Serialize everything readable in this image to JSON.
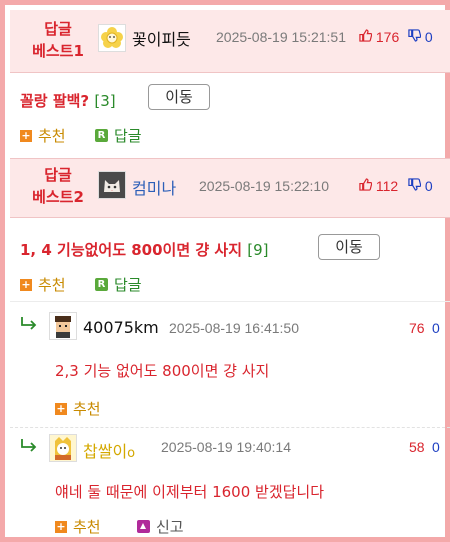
{
  "best1": {
    "label_line1": "답글",
    "label_line2": "베스트1",
    "nick": "꽃이피듯",
    "date": "2025-08-19 15:21:51",
    "up": "176",
    "down": "0",
    "title": "꼴랑 팔백?",
    "count": "[3]",
    "move_btn": "이동",
    "recommend": "추천",
    "reply": "답글",
    "avatar_icon": "flower-icon"
  },
  "best2": {
    "label_line1": "답글",
    "label_line2": "베스트2",
    "nick": "컴미나",
    "date": "2025-08-19 15:22:10",
    "up": "112",
    "down": "0",
    "title": "1, 4 기능없어도 800이면 걍 사지",
    "count": "[9]",
    "move_btn": "이동",
    "recommend": "추천",
    "reply": "답글",
    "avatar_icon": "cat-icon"
  },
  "replies": [
    {
      "nick": "40075km",
      "date": "2025-08-19 16:41:50",
      "up": "76",
      "down": "0",
      "text": "2,3 기능 없어도 800이면 걍 사지",
      "recommend": "추천"
    },
    {
      "nick": "찹쌀이",
      "nick_mark": "o",
      "date": "2025-08-19 19:40:14",
      "up": "58",
      "down": "0",
      "text": "얘네 둘 때문에 이제부터 1600 받겠답니다",
      "recommend": "추천",
      "report": "신고"
    }
  ],
  "icons": {
    "thumb_up": "thumbs-up-icon",
    "thumb_down": "thumbs-down-icon",
    "reply_arrow": "reply-arrow-icon"
  },
  "colors": {
    "accent_red": "#d9252e",
    "accent_blue": "#1d3fc2",
    "border_pink": "#f4a9aa",
    "best_bg": "#fde8e8"
  }
}
